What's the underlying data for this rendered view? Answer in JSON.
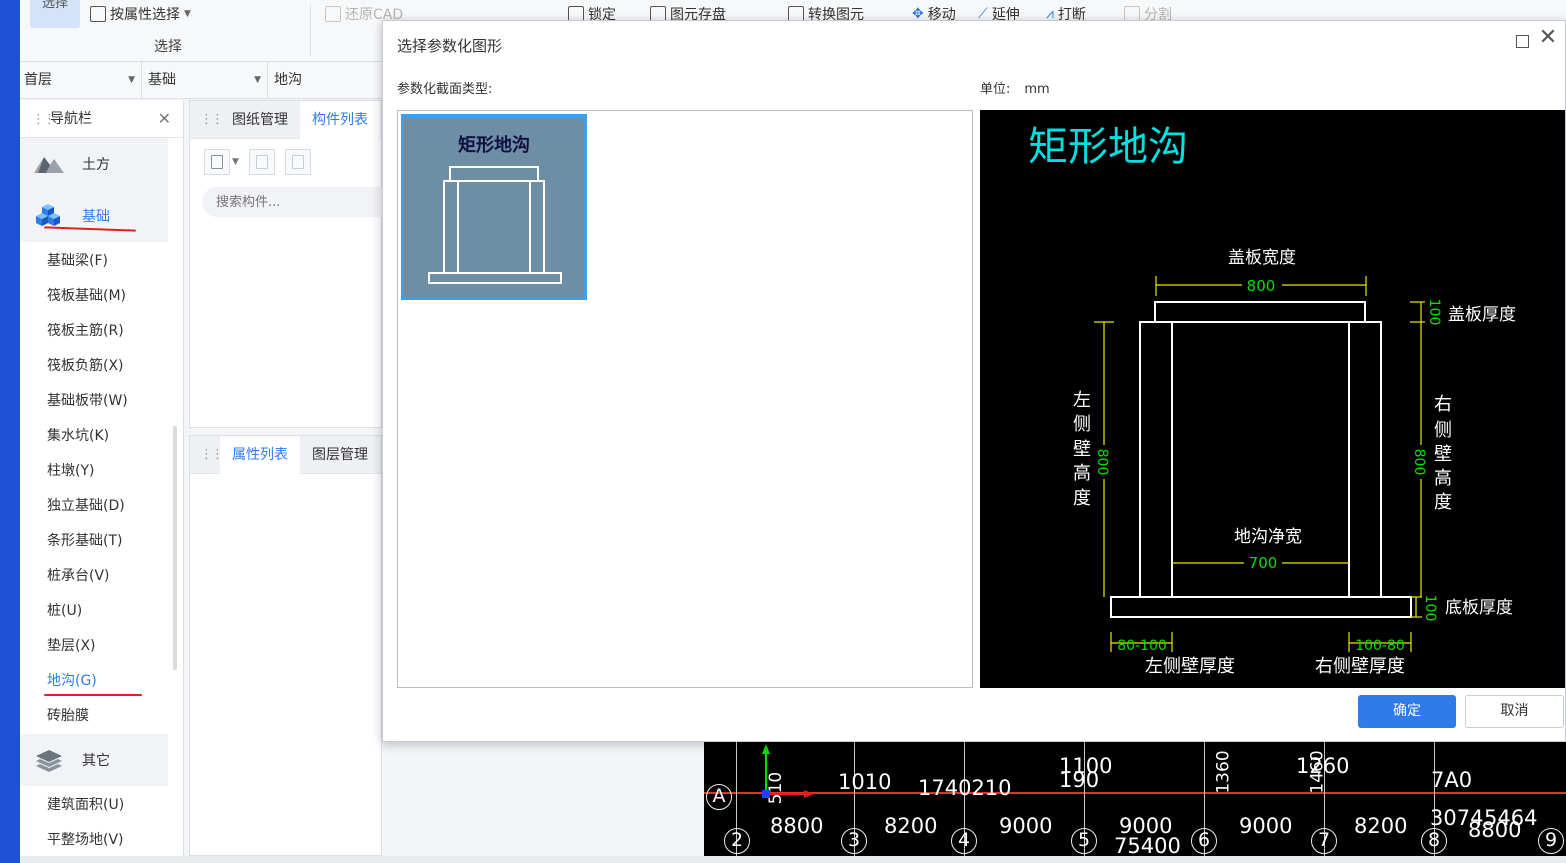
{
  "ribbon": {
    "select_btn": "选择",
    "attr_select": "按属性选择",
    "restore_cad": "还原CAD",
    "lock": "锁定",
    "save_elem": "图元存盘",
    "convert_elem": "转换图元",
    "move": "移动",
    "extend": "延伸",
    "break": "打断",
    "split": "分割",
    "group_select": "选择"
  },
  "floorbar": {
    "floor": "首层",
    "category": "基础",
    "element": "地沟"
  },
  "nav": {
    "title": "导航栏",
    "categories": {
      "earth": "土方",
      "foundation": "基础",
      "other": "其它"
    },
    "items": [
      "基础梁(F)",
      "筏板基础(M)",
      "筏板主筋(R)",
      "筏板负筋(X)",
      "基础板带(W)",
      "集水坑(K)",
      "柱墩(Y)",
      "独立基础(D)",
      "条形基础(T)",
      "桩承台(V)",
      "桩(U)",
      "垫层(X)",
      "地沟(G)",
      "砖胎膜"
    ],
    "other_items": [
      "建筑面积(U)",
      "平整场地(V)"
    ]
  },
  "mid": {
    "tab_drawing": "图纸管理",
    "tab_component": "构件列表",
    "search_placeholder": "搜索构件...",
    "tab_property": "属性列表",
    "tab_layer": "图层管理"
  },
  "dialog": {
    "title": "选择参数化图形",
    "type_label": "参数化截面类型:",
    "unit_label": "单位:",
    "unit_value": "mm",
    "thumb_label": "矩形地沟",
    "ok": "确定",
    "cancel": "取消",
    "preview": {
      "title": "矩形地沟",
      "cover_width_label": "盖板宽度",
      "cover_width": "800",
      "cover_thick_label": "盖板厚度",
      "cover_thick": "100",
      "left_h_label": [
        "左",
        "侧",
        "壁",
        "高",
        "度"
      ],
      "left_h": "800",
      "right_h_label": [
        "右",
        "侧",
        "壁",
        "高",
        "度"
      ],
      "right_h": "800",
      "net_width_label": "地沟净宽",
      "net_width": "700",
      "bottom_thick_label": "底板厚度",
      "bottom_thick": "100",
      "left_dims": "80-100",
      "right_dims": "100-80",
      "left_wall_label": "左侧壁厚度",
      "right_wall_label": "右侧壁厚度"
    }
  },
  "cad": {
    "texts": [
      "1100",
      "190",
      "1010",
      "1740210",
      "1360",
      "1460",
      "1260",
      "1360",
      "7A0",
      "8800",
      "8200",
      "9000",
      "9000",
      "75400",
      "9000",
      "8200",
      "3074",
      "5464",
      "8800",
      "510",
      "2",
      "3",
      "4",
      "5",
      "6",
      "7",
      "8",
      "9",
      "A"
    ]
  },
  "colors": {
    "accent": "#2f7ce8",
    "underline": "#e02020",
    "cad_yellow": "#e8e800",
    "cad_cyan": "#00e0e0",
    "cad_green": "#00e000"
  }
}
